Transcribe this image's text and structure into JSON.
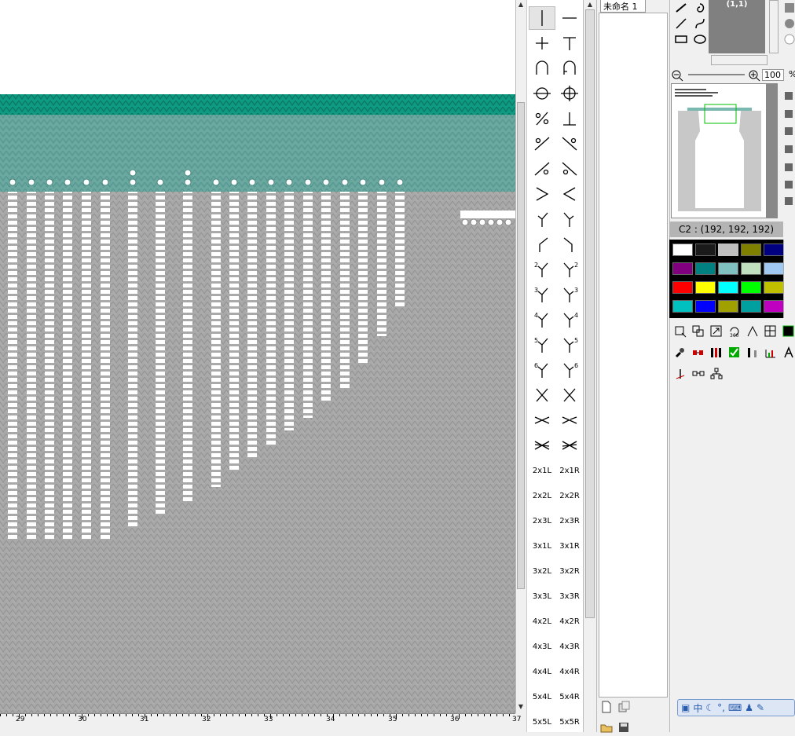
{
  "document": {
    "tab_label": "未命名 1"
  },
  "ruler": {
    "labels": [
      "29",
      "30",
      "31",
      "32",
      "33",
      "34",
      "35",
      "36",
      "37"
    ]
  },
  "palette": {
    "symbols": [
      {
        "name": "knit-stitch",
        "kind": "svg",
        "shape": "vline"
      },
      {
        "name": "purl-stitch",
        "kind": "svg",
        "shape": "hline"
      },
      {
        "name": "tuck-stitch",
        "kind": "svg",
        "shape": "plus"
      },
      {
        "name": "tuck-t-stitch",
        "kind": "svg",
        "shape": "T"
      },
      {
        "name": "loop-stitch",
        "kind": "svg",
        "shape": "arch"
      },
      {
        "name": "loop-stitch-b",
        "kind": "svg",
        "shape": "arch2"
      },
      {
        "name": "circle-stitch",
        "kind": "svg",
        "shape": "circle"
      },
      {
        "name": "circle-cross-stitch",
        "kind": "svg",
        "shape": "circlecross"
      },
      {
        "name": "transfer-left",
        "kind": "svg",
        "shape": "pct"
      },
      {
        "name": "transfer-inv-t",
        "kind": "svg",
        "shape": "invT"
      },
      {
        "name": "transfer-left-2",
        "kind": "svg",
        "shape": "slashA"
      },
      {
        "name": "transfer-right-2",
        "kind": "svg",
        "shape": "slashB"
      },
      {
        "name": "transfer-left-3",
        "kind": "svg",
        "shape": "slashC"
      },
      {
        "name": "transfer-right-3",
        "kind": "svg",
        "shape": "slashD"
      },
      {
        "name": "decrease-right",
        "kind": "svg",
        "shape": "gt"
      },
      {
        "name": "decrease-left",
        "kind": "svg",
        "shape": "lt"
      },
      {
        "name": "move-left-1",
        "kind": "svg",
        "shape": "yL"
      },
      {
        "name": "move-right-1",
        "kind": "svg",
        "shape": "yR"
      },
      {
        "name": "move-left-step",
        "kind": "svg",
        "shape": "kneeL"
      },
      {
        "name": "move-right-step",
        "kind": "svg",
        "shape": "kneeR"
      },
      {
        "name": "move-left-2",
        "kind": "svg",
        "shape": "yL",
        "num": "2"
      },
      {
        "name": "move-right-2",
        "kind": "svg",
        "shape": "yR",
        "num": "2"
      },
      {
        "name": "move-left-3",
        "kind": "svg",
        "shape": "yL",
        "num": "3"
      },
      {
        "name": "move-right-3",
        "kind": "svg",
        "shape": "yR",
        "num": "3"
      },
      {
        "name": "move-left-4",
        "kind": "svg",
        "shape": "yL",
        "num": "4"
      },
      {
        "name": "move-right-4",
        "kind": "svg",
        "shape": "yR",
        "num": "4"
      },
      {
        "name": "move-left-5",
        "kind": "svg",
        "shape": "yL",
        "num": "5"
      },
      {
        "name": "move-right-5",
        "kind": "svg",
        "shape": "yR",
        "num": "5"
      },
      {
        "name": "move-left-6",
        "kind": "svg",
        "shape": "yL",
        "num": "6"
      },
      {
        "name": "move-right-6",
        "kind": "svg",
        "shape": "yR",
        "num": "6"
      },
      {
        "name": "cross-a",
        "kind": "svg",
        "shape": "X"
      },
      {
        "name": "cross-b",
        "kind": "svg",
        "shape": "X"
      },
      {
        "name": "cable-1x1-a",
        "kind": "svg",
        "shape": "cable"
      },
      {
        "name": "cable-1x1-b",
        "kind": "svg",
        "shape": "cable2"
      },
      {
        "name": "cable-2x2-a",
        "kind": "svg",
        "shape": "cable3"
      },
      {
        "name": "cable-2x2-b",
        "kind": "svg",
        "shape": "cable4"
      },
      {
        "name": "cable-2x1L",
        "kind": "text",
        "label": "2x1L"
      },
      {
        "name": "cable-2x1R",
        "kind": "text",
        "label": "2x1R"
      },
      {
        "name": "cable-2x2L",
        "kind": "text",
        "label": "2x2L"
      },
      {
        "name": "cable-2x2R",
        "kind": "text",
        "label": "2x2R"
      },
      {
        "name": "cable-2x3L",
        "kind": "text",
        "label": "2x3L"
      },
      {
        "name": "cable-2x3R",
        "kind": "text",
        "label": "2x3R"
      },
      {
        "name": "cable-3x1L",
        "kind": "text",
        "label": "3x1L"
      },
      {
        "name": "cable-3x1R",
        "kind": "text",
        "label": "3x1R"
      },
      {
        "name": "cable-3x2L",
        "kind": "text",
        "label": "3x2L"
      },
      {
        "name": "cable-3x2R",
        "kind": "text",
        "label": "3x2R"
      },
      {
        "name": "cable-3x3L",
        "kind": "text",
        "label": "3x3L"
      },
      {
        "name": "cable-3x3R",
        "kind": "text",
        "label": "3x3R"
      },
      {
        "name": "cable-4x2L",
        "kind": "text",
        "label": "4x2L"
      },
      {
        "name": "cable-4x2R",
        "kind": "text",
        "label": "4x2R"
      },
      {
        "name": "cable-4x3L",
        "kind": "text",
        "label": "4x3L"
      },
      {
        "name": "cable-4x3R",
        "kind": "text",
        "label": "4x3R"
      },
      {
        "name": "cable-4x4L",
        "kind": "text",
        "label": "4x4L"
      },
      {
        "name": "cable-4x4R",
        "kind": "text",
        "label": "4x4R"
      },
      {
        "name": "cable-5x4L",
        "kind": "text",
        "label": "5x4L"
      },
      {
        "name": "cable-5x4R",
        "kind": "text",
        "label": "5x4R"
      },
      {
        "name": "cable-5x5L",
        "kind": "text",
        "label": "5x5L"
      },
      {
        "name": "cable-5x5R",
        "kind": "text",
        "label": "5x5R"
      }
    ]
  },
  "preview": {
    "coord": "(1,1)"
  },
  "zoom": {
    "value": "100",
    "unit": "%"
  },
  "color_info": {
    "text": "C2 : (192, 192, 192)"
  },
  "colors": {
    "knit_gray": "#a9a9a9",
    "teal": "#6aa8a0",
    "teal_dark": "#0f9b83",
    "swatches": [
      "#ffffff",
      "#1a1a1a",
      "#c0c0c0",
      "#808000",
      "#000080",
      "#800080",
      "#008080",
      "#80c0c0",
      "#c0e0c0",
      "#a0c8f0",
      "#ff0000",
      "#ffff00",
      "#00ffff",
      "#00ff00",
      "#c0c000",
      "#00c0c0",
      "#0000ff",
      "#a0a000",
      "#00a0a0",
      "#c000c0"
    ]
  },
  "ime": {
    "label": "中"
  }
}
